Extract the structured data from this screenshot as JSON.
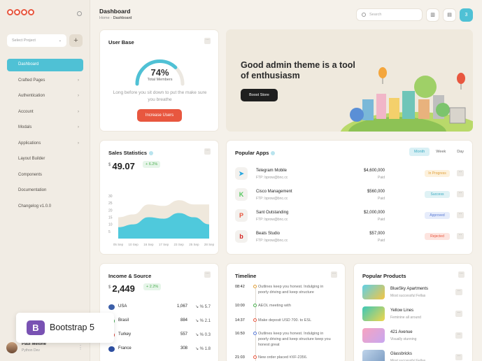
{
  "sidebar": {
    "project_placeholder": "Select Project",
    "add_label": "+",
    "items": [
      {
        "label": "Dashboard",
        "arrow": ""
      },
      {
        "label": "Crafted Pages",
        "arrow": "›"
      },
      {
        "label": "Authentication",
        "arrow": "›"
      },
      {
        "label": "Account",
        "arrow": "›"
      },
      {
        "label": "Modals",
        "arrow": "›"
      },
      {
        "label": "Applications",
        "arrow": "›"
      },
      {
        "label": "Layout Builder",
        "arrow": ""
      },
      {
        "label": "Components",
        "arrow": ""
      },
      {
        "label": "Documentation",
        "arrow": ""
      },
      {
        "label": "Changelog v1.0.0",
        "arrow": ""
      }
    ],
    "user": {
      "name": "Paul Melone",
      "role": "Python Dev"
    }
  },
  "header": {
    "title": "Dashboard",
    "breadcrumb_home": "Home",
    "breadcrumb_sep": " - ",
    "breadcrumb_current": "Dashboard",
    "search_placeholder": "Search",
    "notif_count": "3"
  },
  "user_base": {
    "title": "User Base",
    "percent_label": "74%",
    "percent_value": 0.74,
    "sublabel": "Total Members",
    "description": "Long before you sit down to put the make sure you breathe",
    "button": "Increase Users"
  },
  "banner": {
    "title": "Good admin theme is a tool of enthusiasm",
    "button": "Boost Store"
  },
  "sales": {
    "title": "Sales Statistics",
    "currency": "$",
    "value": "49.07",
    "delta": "+ 6.2%"
  },
  "chart_data": {
    "type": "area",
    "categories": [
      "05 Sep",
      "10 Sep",
      "16 Sep",
      "17 Sep",
      "23 Sep",
      "25 Sep",
      "28 Sep"
    ],
    "yticks": [
      "30",
      "25",
      "20",
      "15",
      "10",
      "5"
    ],
    "ylim": [
      0,
      33
    ],
    "series": [
      {
        "values": [
          15,
          17,
          24,
          23,
          27,
          24,
          24
        ],
        "color": "#efe8dc"
      },
      {
        "values": [
          8,
          10,
          15,
          14,
          18,
          15,
          10
        ],
        "color": "#4fc9dc"
      }
    ],
    "title": "",
    "xlabel": "",
    "ylabel": ""
  },
  "popular_apps": {
    "title": "Popular Apps",
    "tabs": [
      "Month",
      "Week",
      "Day"
    ],
    "rows": [
      {
        "icon": "➤",
        "name": "Telegram Mobile",
        "ftp": "FTP: bprow@bnc.cc",
        "amount": "$4,600,000",
        "paid": "Paid",
        "status": "In Progress",
        "kind": "s-progress",
        "color": "#2aa7df"
      },
      {
        "icon": "K",
        "name": "Cisco Management",
        "ftp": "FTP: bprow@bnc.cc",
        "amount": "$560,000",
        "paid": "Paid",
        "status": "Success",
        "kind": "s-success",
        "color": "#55c85e"
      },
      {
        "icon": "P",
        "name": "Sant Outstanding",
        "ftp": "FTP: bprow@bnc.cc",
        "amount": "$2,000,000",
        "paid": "Paid",
        "status": "Approved",
        "kind": "s-approved",
        "color": "#e8573f"
      },
      {
        "icon": "b",
        "name": "Beats Studio",
        "ftp": "FTP: bprow@bnc.cc",
        "amount": "$57,000",
        "paid": "Paid",
        "status": "Rejected",
        "kind": "s-rejected",
        "color": "#d4211f"
      }
    ]
  },
  "income": {
    "title": "Income & Source",
    "currency": "$",
    "value": "2,449",
    "delta": "+ 2.2%",
    "rows": [
      {
        "name": "USA",
        "value": "1,067",
        "pct": "↘ % 5.7",
        "color": "#3c5fa8"
      },
      {
        "name": "Brasil",
        "value": "884",
        "pct": "↘ % 2.1",
        "color": "#3ca34c"
      },
      {
        "name": "Turkey",
        "value": "557",
        "pct": "↘ % 0.3",
        "color": "#d9362b"
      },
      {
        "name": "France",
        "value": "308",
        "pct": "↘ % 1.8",
        "color": "#2d4ea0"
      }
    ]
  },
  "timeline": {
    "title": "Timeline",
    "items": [
      {
        "time": "08:42",
        "text": "Outlines keep you honest. Indulging in poorly driving and keep structure",
        "accent": "#e0a03b"
      },
      {
        "time": "10:00",
        "text": "AEOL meeting with",
        "accent": "#4caf50"
      },
      {
        "time": "14:37",
        "text": "Make deposit USD 700. to ESL",
        "accent": "#e8573f"
      },
      {
        "time": "16:50",
        "text": "Outlines keep you honest. Indulging in poorly driving and keep structure keep you honest great",
        "accent": "#5b7bd5"
      },
      {
        "time": "21:03",
        "text": "New order placed #XF-2356.",
        "accent": "#e8573f"
      }
    ]
  },
  "products": {
    "title": "Popular Products",
    "items": [
      {
        "name": "BlueSky Apartments",
        "sub": "Most successful Fellas",
        "c1": "#5fd0e6",
        "c2": "#f4c542"
      },
      {
        "name": "Yellow Lines",
        "sub": "Feminine all around",
        "c1": "#3cc7b8",
        "c2": "#f1d64c"
      },
      {
        "name": "421 Avenue",
        "sub": "Visually stunning",
        "c1": "#f7a3c0",
        "c2": "#c7a7f0"
      },
      {
        "name": "Glassbricks",
        "sub": "Most successful Fellas",
        "c1": "#bfd4ea",
        "c2": "#7a9bc2"
      }
    ]
  },
  "bootstrap": {
    "letter": "B",
    "label": "Bootstrap 5"
  }
}
